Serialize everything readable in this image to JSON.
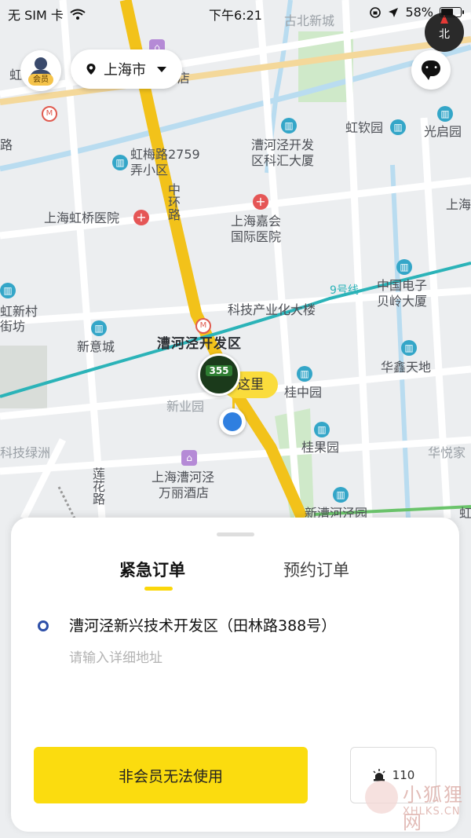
{
  "status_bar": {
    "carrier": "无 SIM 卡",
    "time": "下午6:21",
    "battery": "58%",
    "battery_level": 0.58
  },
  "map": {
    "labels": {
      "gubei": "古北新城",
      "hong_left": "虹",
      "road_lu": "路",
      "zhongjiu": "店",
      "hongqin": "虹钦园",
      "guangqi": "光启园",
      "kehui": "漕河泾开发",
      "kehui2": "区科汇大厦",
      "hongmei": "虹梅路2759",
      "hongmei2": "弄小区",
      "zhonghuan": "中环路",
      "hongqiao_hosp": "上海虹桥医院",
      "jiahui": "上海嘉会",
      "jiahui2": "国际医院",
      "shanghai_right": "上海",
      "line9": "9号线",
      "zhongguo_dianzi": "中国电子",
      "beiling": "贝岭大厦",
      "hongxincun": "虹新村",
      "jiefang": "街坊",
      "keji": "科技产业化大楼",
      "xinyi": "新意城",
      "caohejing": "漕河泾开发区",
      "huaxin": "华鑫天地",
      "guizhong": "桂中园",
      "xinye": "新业园",
      "keji_lvzhou": "科技绿洲",
      "guiguo": "桂果园",
      "huayue": "华悦家",
      "lianhua": "莲花路",
      "wanli": "上海漕河泾",
      "wanli2": "万丽酒店",
      "xincaohejing": "新漕河泾园",
      "hong_right": "虹"
    }
  },
  "top": {
    "member_badge": "会员",
    "city": "上海市",
    "compass_label": "北"
  },
  "marker": {
    "here": "这里",
    "logo_text": "355"
  },
  "sheet": {
    "tab_urgent": "紧急订单",
    "tab_booking": "预约订单",
    "address": "漕河泾新兴技术开发区（田林路388号）",
    "detail_placeholder": "请输入详细地址",
    "primary_button": "非会员无法使用",
    "sos_button": "110"
  },
  "watermark": {
    "name": "小狐狸网",
    "domain": "XHLKS.CN"
  },
  "colors": {
    "accent_yellow": "#fbdc0f",
    "location_blue": "#2f7fe0",
    "metro_teal": "#2bb3b8",
    "address_dot": "#2d4fa8"
  }
}
